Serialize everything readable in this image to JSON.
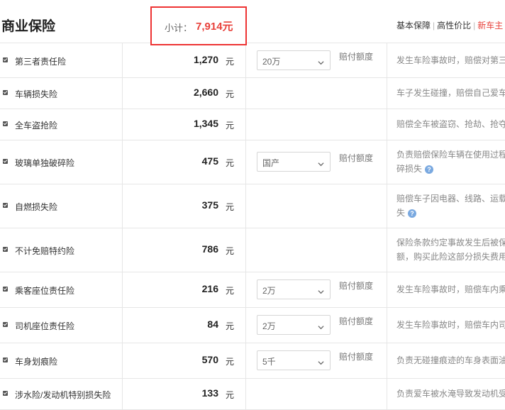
{
  "section_title": "商业保险",
  "subtotal": {
    "label": "小计：",
    "value": "7,914元"
  },
  "top_links": [
    {
      "label": "基本保障"
    },
    {
      "label": "高性价比"
    },
    {
      "label": "新车主"
    }
  ],
  "unit": "元",
  "coverage_label": "赔付额度",
  "rows": [
    {
      "name": "第三者责任险",
      "amount": "1,270",
      "select": "20万",
      "desc1": "发生车险事故时，赔偿对第三",
      "desc2": ""
    },
    {
      "name": "车辆损失险",
      "amount": "2,660",
      "select": null,
      "desc1": "车子发生碰撞，赔偿自己爱车",
      "desc2": ""
    },
    {
      "name": "全车盗抢险",
      "amount": "1,345",
      "select": null,
      "desc1": "赔偿全车被盗窃、抢劫、抢夺",
      "desc2": ""
    },
    {
      "name": "玻璃单独破碎险",
      "amount": "475",
      "select": "国产",
      "desc1": "负责赔偿保险车辆在使用过程",
      "desc2": "碎损失"
    },
    {
      "name": "自燃损失险",
      "amount": "375",
      "select": null,
      "desc1": "赔偿车子因电器、线路、运载",
      "desc2": "失"
    },
    {
      "name": "不计免赔特约险",
      "amount": "786",
      "select": null,
      "desc1": "保险条款约定事故发生后被保",
      "desc2": "额，购买此险这部分损失费用"
    },
    {
      "name": "乘客座位责任险",
      "amount": "216",
      "select": "2万",
      "desc1": "发生车险事故时，赔偿车内乘",
      "desc2": ""
    },
    {
      "name": "司机座位责任险",
      "amount": "84",
      "select": "2万",
      "desc1": "发生车险事故时，赔偿车内司",
      "desc2": ""
    },
    {
      "name": "车身划痕险",
      "amount": "570",
      "select": "5千",
      "desc1": "负责无碰撞痕迹的车身表面油",
      "desc2": ""
    },
    {
      "name": "涉水险/发动机特别损失险",
      "amount": "133",
      "select": null,
      "desc1": "负责爱车被水淹导致发动机受",
      "desc2": ""
    }
  ]
}
